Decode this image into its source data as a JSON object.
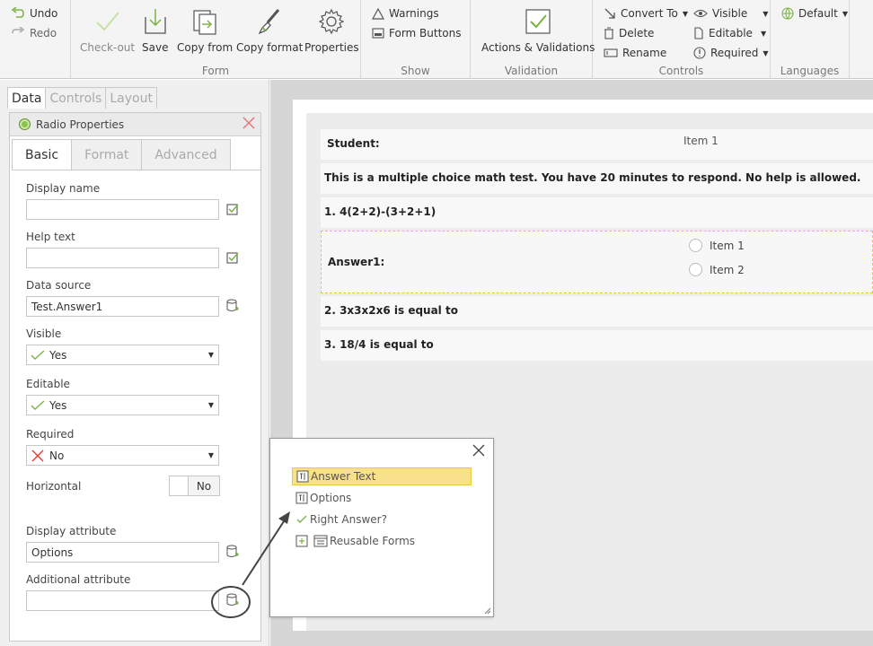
{
  "ribbon": {
    "undo": "Undo",
    "redo": "Redo",
    "checkout": "Check-out",
    "save": "Save",
    "copy_from": "Copy from",
    "copy_format": "Copy format",
    "properties": "Properties",
    "form_group": "Form",
    "warnings": "Warnings",
    "form_buttons": "Form Buttons",
    "show_group": "Show",
    "actions_validations": "Actions & Validations",
    "validation_group": "Validation",
    "convert_to": "Convert To",
    "delete": "Delete",
    "rename": "Rename",
    "visible": "Visible",
    "editable": "Editable",
    "required": "Required",
    "controls_group": "Controls",
    "default_lang": "Default",
    "languages_group": "Languages"
  },
  "panel": {
    "tabs": [
      "Data",
      "Controls",
      "Layout"
    ],
    "active_tab": "Data",
    "title": "Radio Properties",
    "subtabs": [
      "Basic",
      "Format",
      "Advanced"
    ],
    "active_subtab": "Basic",
    "display_name_label": "Display name",
    "display_name_value": "",
    "help_text_label": "Help text",
    "help_text_value": "",
    "data_source_label": "Data source",
    "data_source_value": "Test.Answer1",
    "visible_label": "Visible",
    "visible_value": "Yes",
    "editable_label": "Editable",
    "editable_value": "Yes",
    "required_label": "Required",
    "required_value": "No",
    "horizontal_label": "Horizontal",
    "horizontal_value": "No",
    "display_attribute_label": "Display attribute",
    "display_attribute_value": "Options",
    "additional_attribute_label": "Additional attribute",
    "additional_attribute_value": ""
  },
  "form": {
    "student_label": "Student:",
    "student_value": "Item 1",
    "intro": "This is a multiple choice math test. You have 20 minutes to respond. No help is allowed.",
    "q1": "1. 4(2+2)-(3+2+1)",
    "answer1_label": "Answer1:",
    "answer1_options": [
      "Item 1",
      "Item 2"
    ],
    "q2": "2. 3x3x2x6 is equal to",
    "q3": "3. 18/4 is equal to"
  },
  "popup": {
    "items": [
      {
        "label": "Answer Text",
        "icon": "field-icon",
        "highlighted": true
      },
      {
        "label": "Options",
        "icon": "field-icon",
        "highlighted": false
      },
      {
        "label": "Right Answer?",
        "icon": "check-icon",
        "highlighted": false
      },
      {
        "label": "Reusable Forms",
        "icon": "forms-icon",
        "highlighted": false
      }
    ]
  },
  "colors": {
    "accent_green": "#8bc34a",
    "highlight_yellow": "#f9e08a",
    "error_red": "#e53935"
  }
}
